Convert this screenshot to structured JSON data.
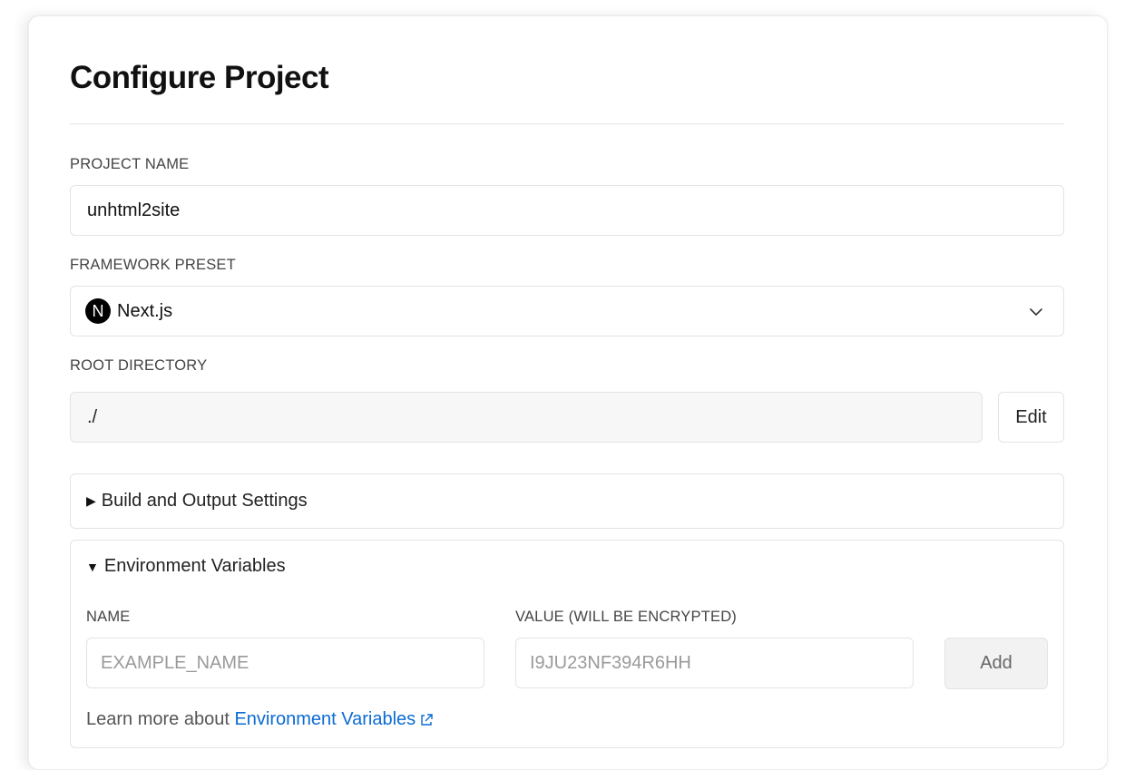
{
  "page": {
    "title": "Configure Project"
  },
  "project_name": {
    "label": "PROJECT NAME",
    "value": "unhtml2site"
  },
  "framework": {
    "label": "FRAMEWORK PRESET",
    "logo_letter": "N",
    "selected": "Next.js",
    "icon": "chevron-down-icon"
  },
  "root_directory": {
    "label": "ROOT DIRECTORY",
    "value": "./",
    "edit_label": "Edit"
  },
  "build_settings": {
    "label": "Build and Output Settings",
    "expanded": false
  },
  "env_vars": {
    "label": "Environment Variables",
    "expanded": true,
    "name_label": "NAME",
    "name_placeholder": "EXAMPLE_NAME",
    "value_label": "VALUE (WILL BE ENCRYPTED)",
    "value_placeholder": "I9JU23NF394R6HH",
    "add_label": "Add",
    "learn_prefix": "Learn more about",
    "learn_link": "Environment Variables"
  },
  "colors": {
    "link": "#0b6bd3",
    "border": "#e3e3e3",
    "muted": "#9a9a9a"
  }
}
